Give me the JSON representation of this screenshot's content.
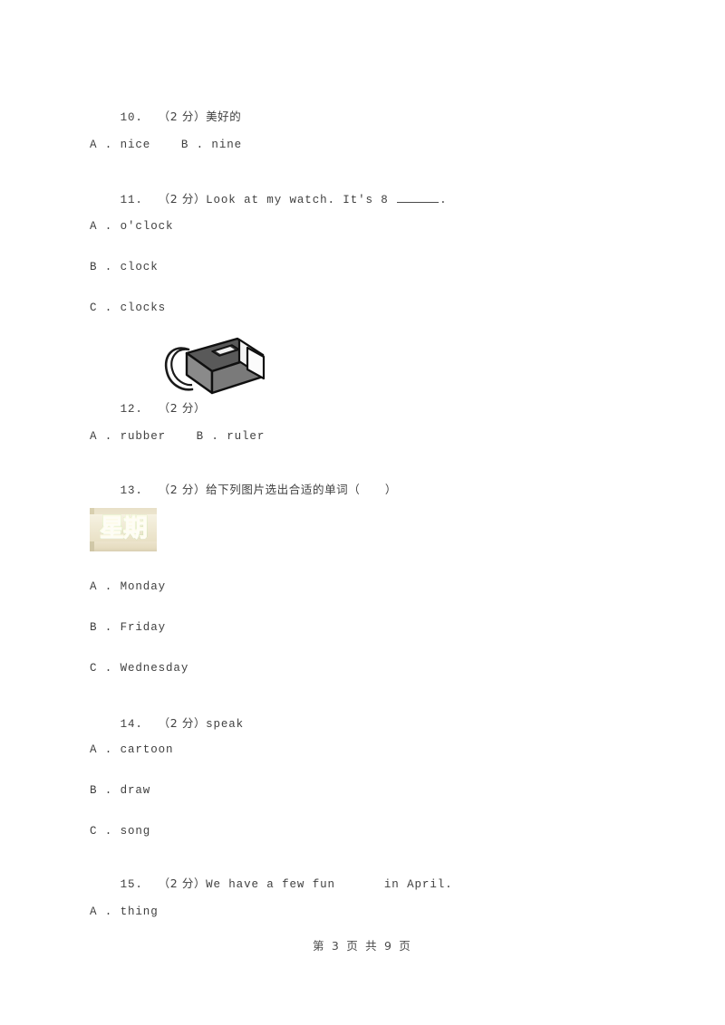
{
  "document": {
    "page_label": "第 3 页 共 9 页"
  },
  "questions": [
    {
      "number": "10.",
      "score": "（2 分）",
      "stem_cjk": "美好的",
      "stem_en": "",
      "options_inline": "A . nice    B . nine"
    },
    {
      "number": "11.",
      "score": "（2 分）",
      "stem_en_before": "Look at my watch. It's 8 ",
      "stem_en_after": ".",
      "options": [
        "A . o'clock",
        "B . clock",
        "C . clocks"
      ]
    },
    {
      "number": "12.",
      "score": "（2 分）",
      "figure": "eraser-illustration",
      "options_inline": "A . rubber    B . ruler"
    },
    {
      "number": "13.",
      "score": "（2 分）",
      "stem_cjk": "给下列图片选出合适的单词（      ）",
      "figure": "wednesday-word-image",
      "figure_text": "星期三",
      "options": [
        "A . Monday",
        "B . Friday",
        "C . Wednesday"
      ]
    },
    {
      "number": "14.",
      "score": "（2 分）",
      "stem_en": "speak",
      "options": [
        "A . cartoon",
        "B . draw",
        "C . song"
      ]
    },
    {
      "number": "15.",
      "score": "（2 分）",
      "stem_en_before": "We have a few fun",
      "stem_en_after": "in April.",
      "options": [
        "A . thing"
      ]
    }
  ],
  "colors": {
    "page_background": "#ffffff",
    "text": "#404040",
    "figure_green_light": "#8fe06a",
    "figure_green_dark": "#1e7a18",
    "figure_paper": "#efe8d2",
    "eraser_top": "#595959",
    "eraser_front": "#7d7d7d",
    "eraser_tip": "#f2f2f2"
  }
}
